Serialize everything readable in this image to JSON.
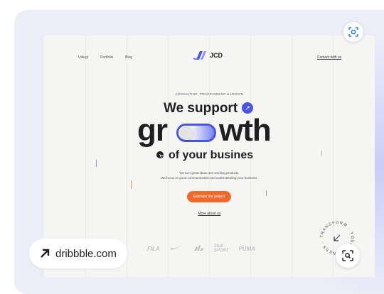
{
  "source": {
    "label": "dribbble.com"
  },
  "site": {
    "nav": [
      "Usługi",
      "Portfolio",
      "Blog"
    ],
    "logo": {
      "name": "JCD",
      "color": "#4a55e0"
    },
    "contact_label": "Contact with us",
    "hero": {
      "kicker": "CONSULTING, PROGRAMMING & DESIGN",
      "line1": "We support",
      "big_left": "gr",
      "big_right": "wth",
      "line3": "of your busines",
      "desc1": "We turn great ideas into working products.",
      "desc2": "We focus on good communication and understanding your business.",
      "cta_label": "Estimate the project",
      "more_label": "More about us"
    },
    "brands": [
      "FILA",
      "NIKE",
      "adidas",
      "Stoll SPORT",
      "PUMA"
    ],
    "badge_text": "TRANSFORM YOUR BUSINESS",
    "accent": "#4a55e0",
    "cta_color": "#ef6a2f"
  },
  "icons": {
    "lens_top": "google-lens-icon",
    "lens_bottom": "zoom-search-icon",
    "source_arrow": "arrow-up-right-icon"
  }
}
